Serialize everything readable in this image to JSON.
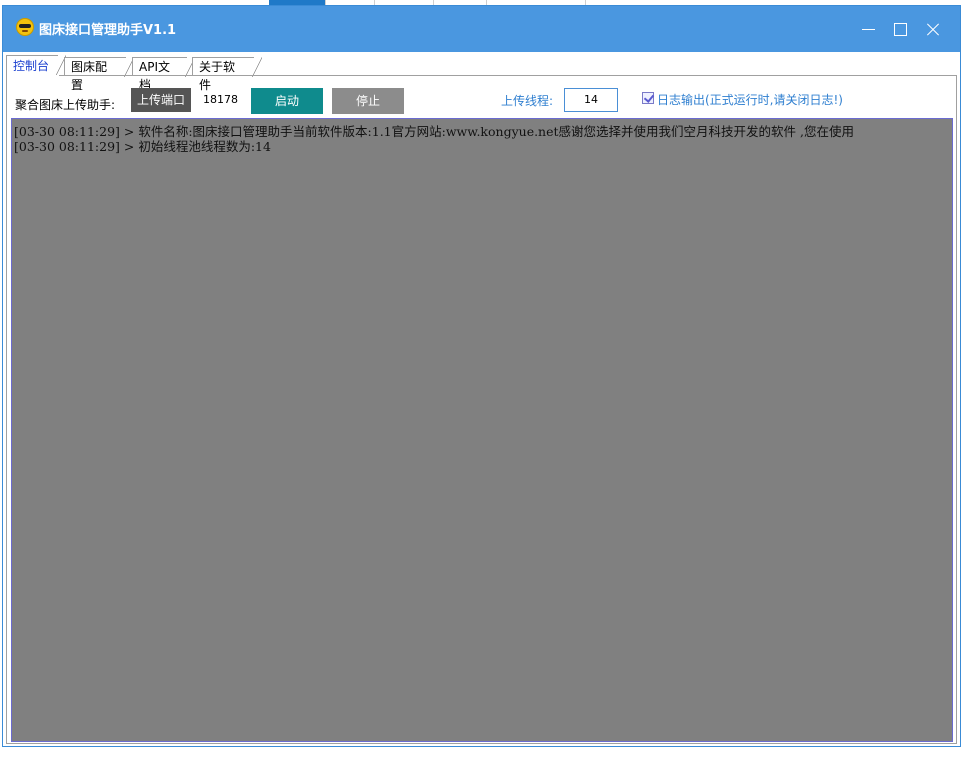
{
  "window": {
    "title": "图床接口管理助手V1.1"
  },
  "tabs": [
    {
      "label": "控制台",
      "active": true
    },
    {
      "label": "图床配置",
      "active": false
    },
    {
      "label": "API文档",
      "active": false
    },
    {
      "label": "关于软件",
      "active": false
    }
  ],
  "toolbar": {
    "helper_label": "聚合图床上传助手:",
    "port_button": "上传端口",
    "port_value": "18178",
    "start_button": "启动",
    "stop_button": "停止",
    "thread_label": "上传线程:",
    "thread_value": "14",
    "log_checkbox_label": "日志输出(正式运行时,请关闭日志!)",
    "log_checked": true
  },
  "console": {
    "lines": [
      "[03-30 08:11:29] > 软件名称:图床接口管理助手当前软件版本:1.1官方网站:www.kongyue.net感谢您选择并使用我们空月科技开发的软件 ,您在使用",
      "[03-30 08:11:29] > 初始线程池线程数为:14"
    ]
  },
  "colors": {
    "titlebar": "#4a97e0",
    "start_button": "#0f8b8d",
    "stop_button": "#8c8c8c",
    "port_button": "#555555",
    "console_bg": "#808080",
    "accent_text": "#2f7fd0"
  }
}
